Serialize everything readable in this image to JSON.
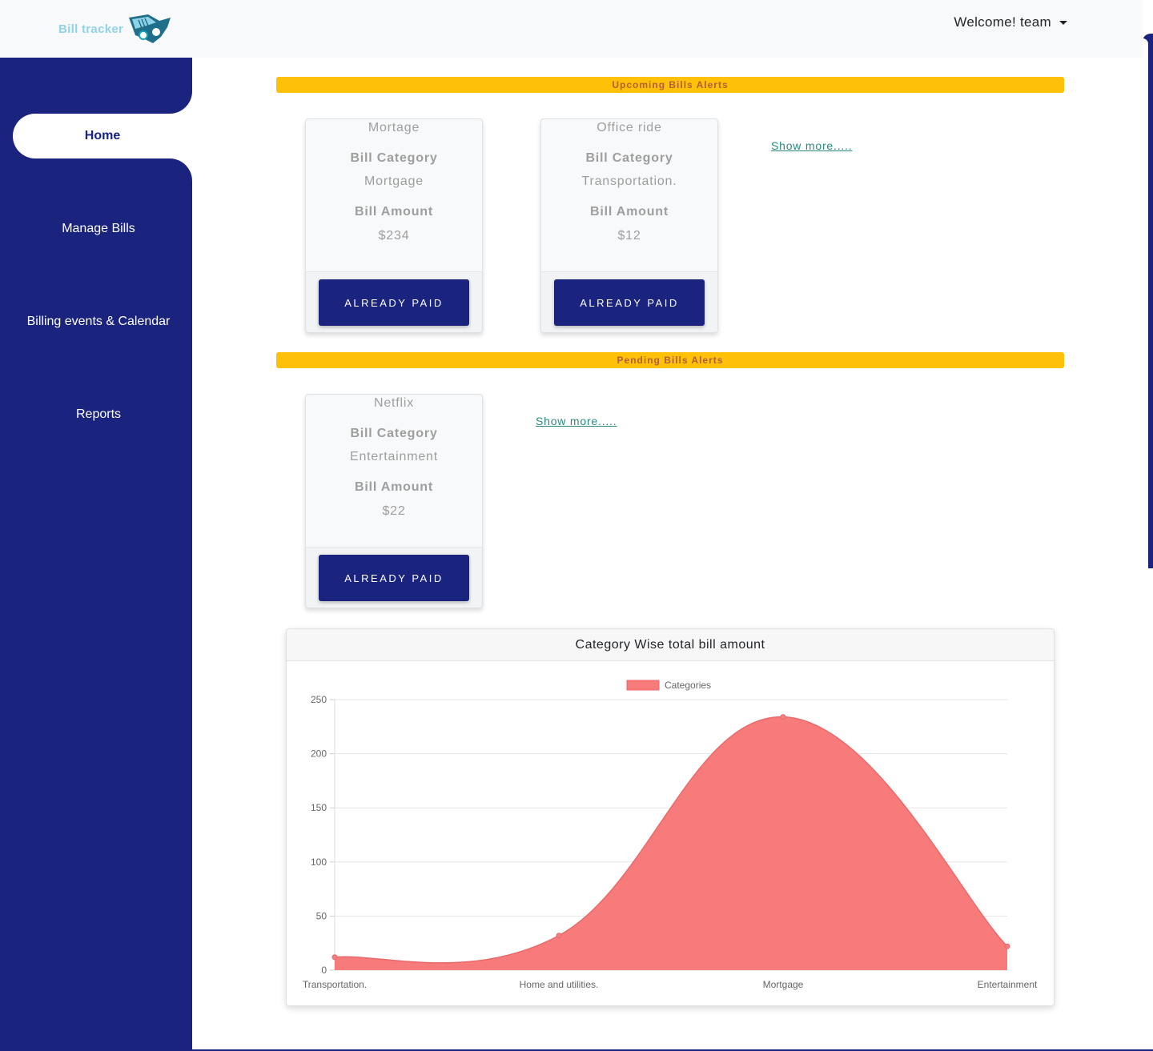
{
  "header": {
    "app_name": "Bill tracker",
    "welcome": "Welcome! team"
  },
  "sidebar": {
    "items": [
      {
        "label": "Home",
        "active": true
      },
      {
        "label": "Manage Bills"
      },
      {
        "label": "Billing events & Calendar"
      },
      {
        "label": "Reports"
      }
    ]
  },
  "upcoming": {
    "title": "Upcoming Bills Alerts",
    "show_more": "Show more.....",
    "cards": [
      {
        "name": "Mortage",
        "category_label": "Bill Category",
        "category": "Mortgage",
        "amount_label": "Bill Amount",
        "amount": "$234",
        "button": "ALREADY PAID"
      },
      {
        "name": "Office ride",
        "category_label": "Bill Category",
        "category": "Transportation.",
        "amount_label": "Bill Amount",
        "amount": "$12",
        "button": "ALREADY PAID"
      }
    ]
  },
  "pending": {
    "title": "Pending Bills Alerts",
    "show_more": "Show more.....",
    "cards": [
      {
        "name": "Netflix",
        "category_label": "Bill Category",
        "category": "Entertainment",
        "amount_label": "Bill Amount",
        "amount": "$22",
        "button": "ALREADY PAID"
      }
    ]
  },
  "chart_data": {
    "type": "area",
    "title": "Category Wise total bill amount",
    "categories": [
      "Transportation.",
      "Home and utilities.",
      "Mortgage",
      "Entertainment"
    ],
    "series": [
      {
        "name": "Categories",
        "values": [
          12,
          32,
          234,
          22
        ]
      }
    ],
    "ylim": [
      0,
      250
    ],
    "yticks": [
      0,
      50,
      100,
      150,
      200,
      250
    ],
    "legend": "top",
    "grid": true,
    "colors": {
      "fill": "#f77b7b",
      "stroke": "#e86a6a",
      "point": "#f08080"
    }
  },
  "colors": {
    "primary": "#1a237e",
    "alert": "#ffc107",
    "link": "#2a8a82"
  }
}
